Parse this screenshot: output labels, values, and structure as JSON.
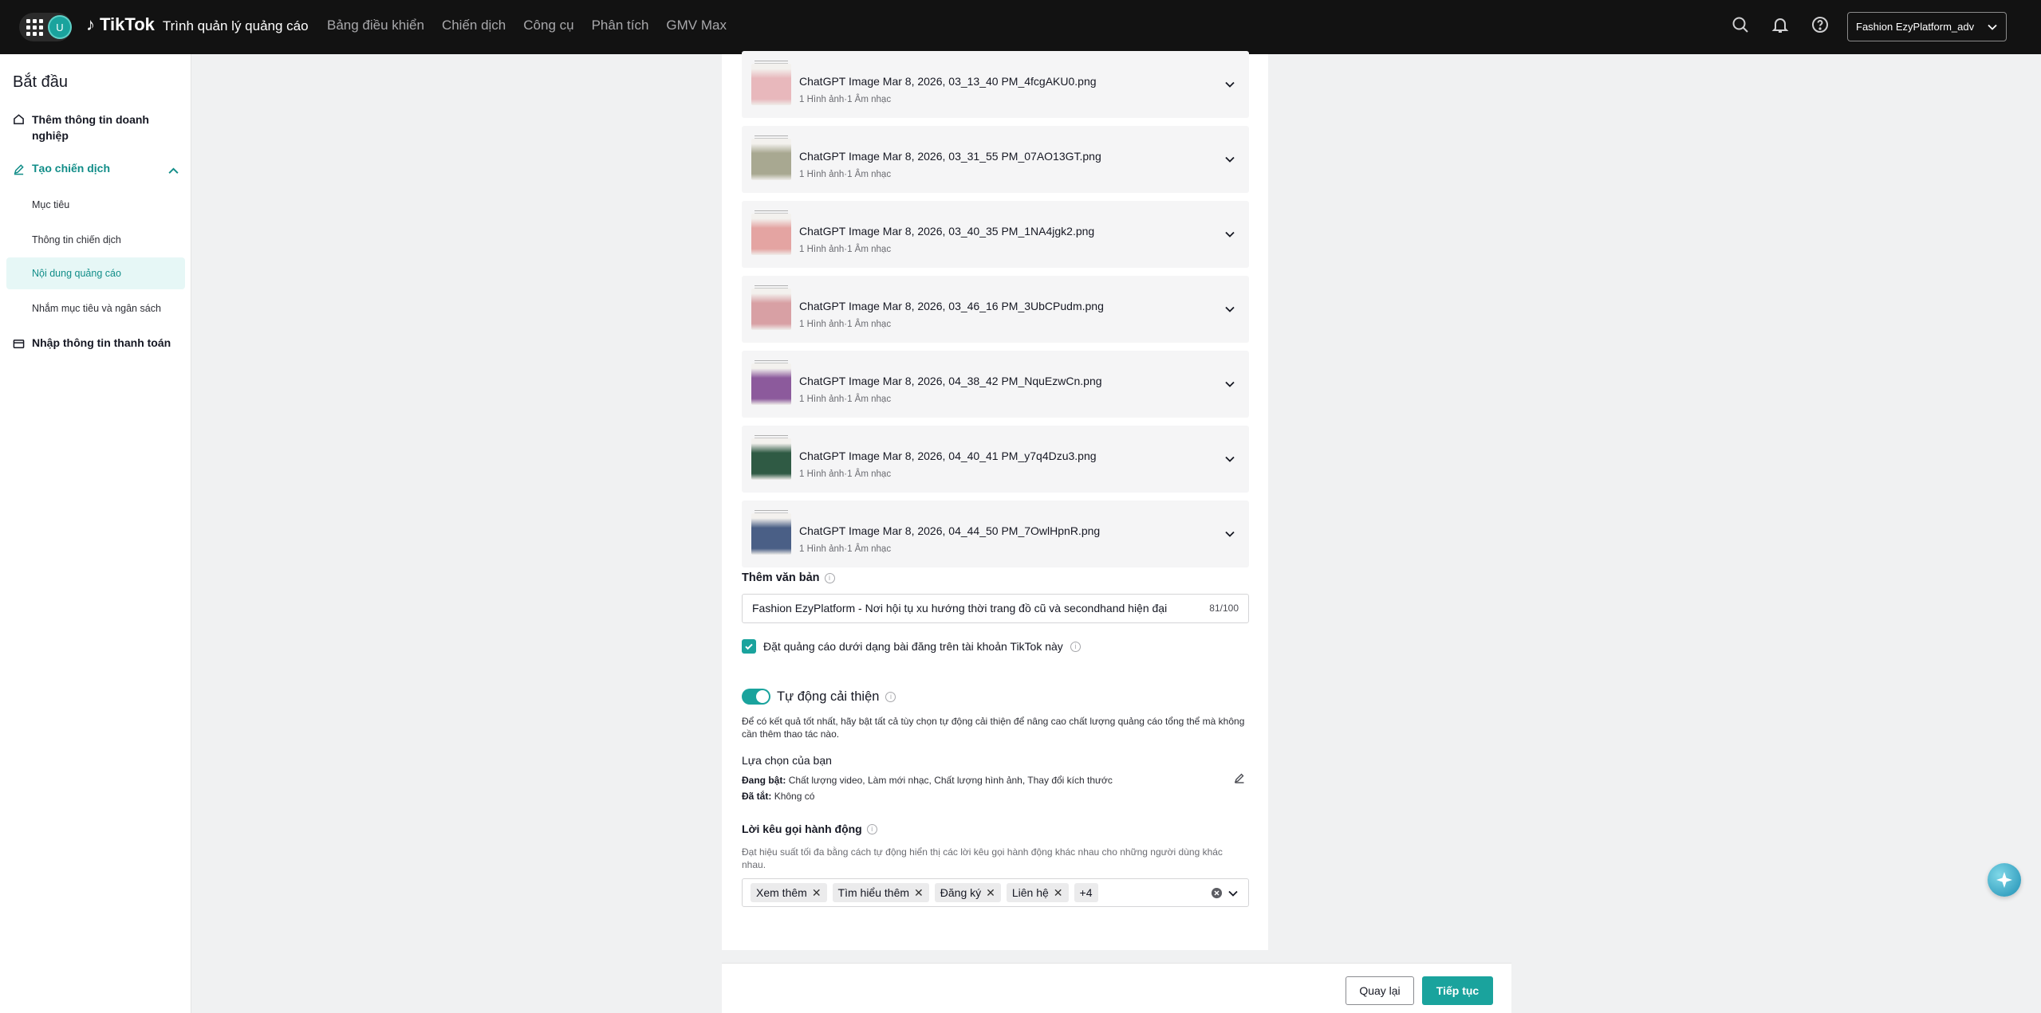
{
  "header": {
    "avatar_initial": "U",
    "brand_name": "TikTok",
    "brand_sub": "Trình quản lý quảng cáo",
    "nav": [
      "Bảng điều khiển",
      "Chiến dịch",
      "Công cụ",
      "Phân tích",
      "GMV Max"
    ],
    "icons": [
      "search-icon",
      "bell-icon",
      "help-icon"
    ],
    "account": "Fashion EzyPlatform_adv"
  },
  "sidebar": {
    "title": "Bắt đầu",
    "business_info": "Thêm thông tin doanh nghiệp",
    "create_campaign": "Tạo chiến dịch",
    "sub_items": [
      "Mục tiêu",
      "Thông tin chiến dịch",
      "Nội dung quảng cáo",
      "Nhắm mục tiêu và ngân sách"
    ],
    "payment": "Nhập thông tin thanh toán"
  },
  "media": {
    "meta": "1 Hình ảnh·1 Âm nhạc",
    "items": [
      {
        "name": "ChatGPT Image Mar 8, 2026, 03_13_40 PM_4fcgAKU0.png",
        "color": "#e8b8bc"
      },
      {
        "name": "ChatGPT Image Mar 8, 2026, 03_31_55 PM_07AO13GT.png",
        "color": "#a8a891"
      },
      {
        "name": "ChatGPT Image Mar 8, 2026, 03_40_35 PM_1NA4jgk2.png",
        "color": "#e4a4a2"
      },
      {
        "name": "ChatGPT Image Mar 8, 2026, 03_46_16 PM_3UbCPudm.png",
        "color": "#d8a0a4"
      },
      {
        "name": "ChatGPT Image Mar 8, 2026, 04_38_42 PM_NquEzwCn.png",
        "color": "#8c5a9c"
      },
      {
        "name": "ChatGPT Image Mar 8, 2026, 04_40_41 PM_y7q4Dzu3.png",
        "color": "#2f5a44"
      },
      {
        "name": "ChatGPT Image Mar 8, 2026, 04_44_50 PM_7OwlHpnR.png",
        "color": "#4a5f86"
      }
    ]
  },
  "text_section": {
    "label": "Thêm văn bản",
    "value": "Fashion EzyPlatform - Nơi hội tụ xu hướng thời trang đồ cũ và secondhand hiện đại",
    "counter": "81/100"
  },
  "post_checkbox": {
    "label": "Đặt quảng cáo dưới dạng bài đăng trên tài khoản TikTok này",
    "checked": true
  },
  "auto_improve": {
    "label": "Tự động cải thiện",
    "enabled": true,
    "description": "Để có kết quả tốt nhất, hãy bật tất cả tùy chọn tự động cải thiện để nâng cao chất lượng quảng cáo tổng thể mà không cần thêm thao tác nào.",
    "choices_label": "Lựa chọn của bạn",
    "on_key": "Đang bật:",
    "on_value": "Chất lượng video, Làm mới nhạc, Chất lượng hình ảnh, Thay đổi kích thước",
    "off_key": "Đã tắt:",
    "off_value": "Không có"
  },
  "cta": {
    "label": "Lời kêu gọi hành động",
    "description": "Đạt hiệu suất tối đa bằng cách tự động hiển thị các lời kêu gọi hành động khác nhau cho những người dùng khác nhau.",
    "tags": [
      "Xem thêm",
      "Tìm hiểu thêm",
      "Đăng ký",
      "Liên hệ"
    ],
    "more": "+4"
  },
  "footer": {
    "back": "Quay lại",
    "next": "Tiếp tục"
  },
  "colors": {
    "accent": "#1aa39d",
    "topbar": "#121212"
  }
}
